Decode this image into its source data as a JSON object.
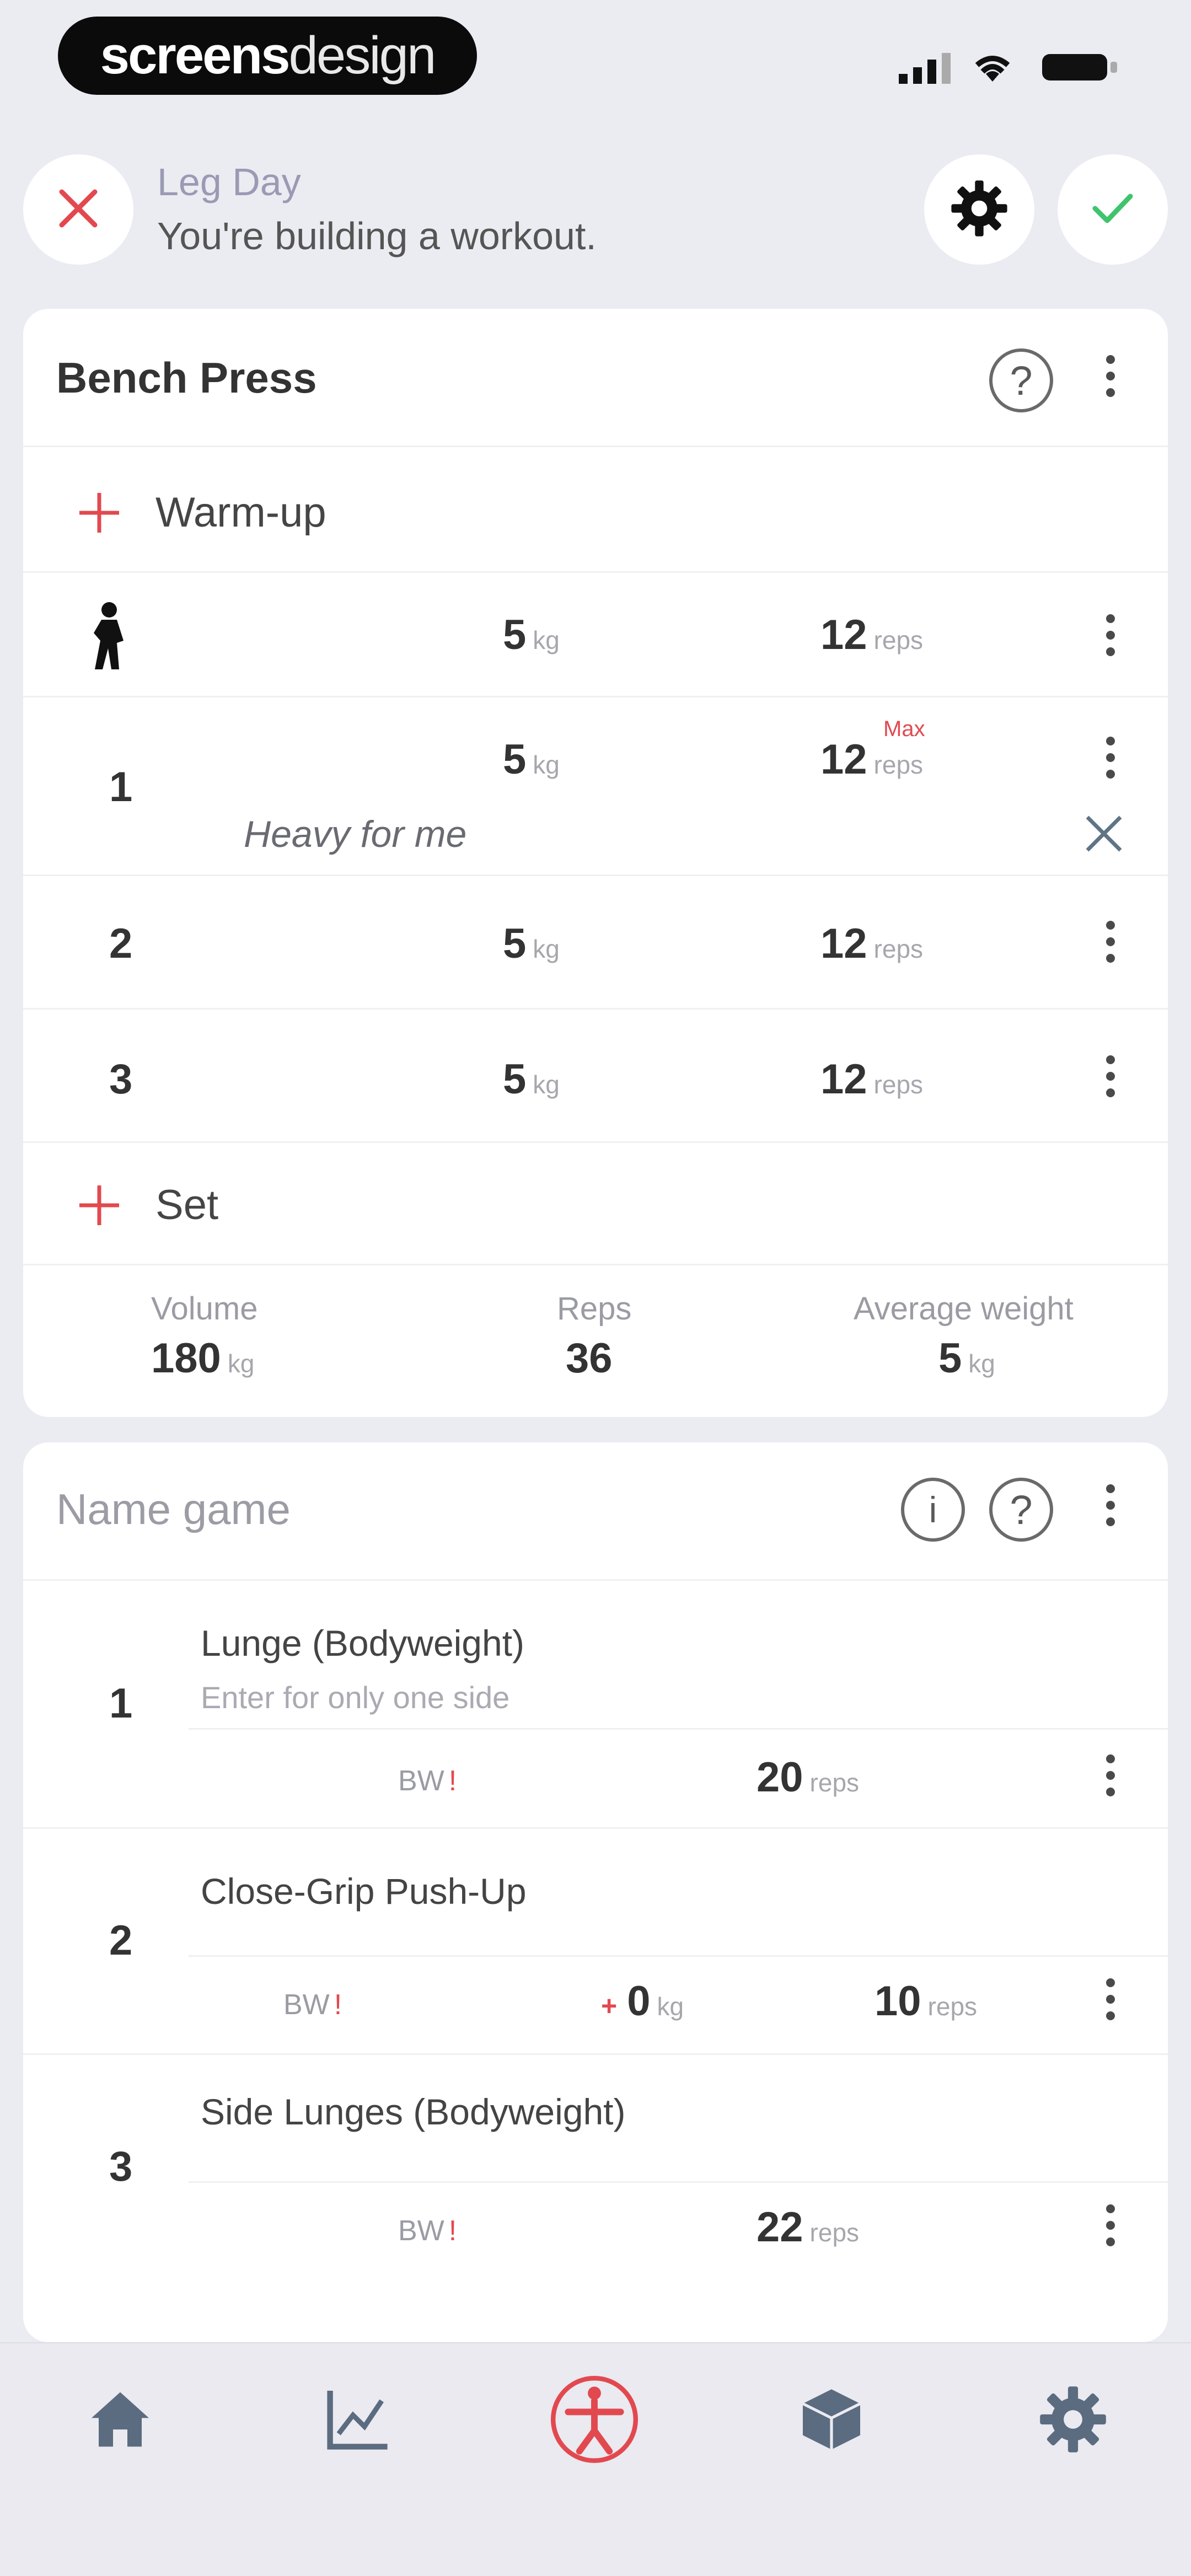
{
  "status_bar": {
    "brand_bold": "screens",
    "brand_light": "design"
  },
  "header": {
    "workout_name": "Leg Day",
    "subtitle": "You're building a workout."
  },
  "exercise_card": {
    "title": "Bench Press",
    "warmup_label": "Warm-up",
    "sets": [
      {
        "index": "",
        "weight": "5",
        "weight_unit": "kg",
        "reps": "12",
        "reps_unit": "reps",
        "flag": "",
        "note": ""
      },
      {
        "index": "1",
        "weight": "5",
        "weight_unit": "kg",
        "reps": "12",
        "reps_unit": "reps",
        "flag": "Max",
        "note": "Heavy for me"
      },
      {
        "index": "2",
        "weight": "5",
        "weight_unit": "kg",
        "reps": "12",
        "reps_unit": "reps",
        "flag": "",
        "note": ""
      },
      {
        "index": "3",
        "weight": "5",
        "weight_unit": "kg",
        "reps": "12",
        "reps_unit": "reps",
        "flag": "",
        "note": ""
      }
    ],
    "add_set_label": "Set",
    "summary": {
      "volume_label": "Volume",
      "volume_value": "180",
      "volume_unit": "kg",
      "reps_label": "Reps",
      "reps_value": "36",
      "avg_label": "Average weight",
      "avg_value": "5",
      "avg_unit": "kg"
    }
  },
  "circuit_card": {
    "placeholder": "Name game",
    "exercises": [
      {
        "index": "1",
        "name": "Lunge (Bodyweight)",
        "hint": "Enter for only one side",
        "bw": "BW",
        "extra": "",
        "extra_unit": "",
        "reps": "20",
        "reps_unit": "reps"
      },
      {
        "index": "2",
        "name": "Close-Grip Push-Up",
        "hint": "",
        "bw": "BW",
        "extra": "0",
        "extra_unit": "kg",
        "reps": "10",
        "reps_unit": "reps"
      },
      {
        "index": "3",
        "name": "Side Lunges (Bodyweight)",
        "hint": "",
        "bw": "BW",
        "extra": "",
        "extra_unit": "",
        "reps": "22",
        "reps_unit": "reps"
      }
    ]
  },
  "colors": {
    "accent_red": "#e2494f",
    "confirm_green": "#3ec46d",
    "nav_icon": "#5b6b80"
  },
  "icons": [
    "close-icon",
    "gear-icon",
    "check-icon",
    "help-icon",
    "more-icon",
    "plus-icon",
    "warmup-person-icon",
    "info-icon",
    "home-icon",
    "chart-icon",
    "workout-icon",
    "cube-icon",
    "settings-icon"
  ]
}
